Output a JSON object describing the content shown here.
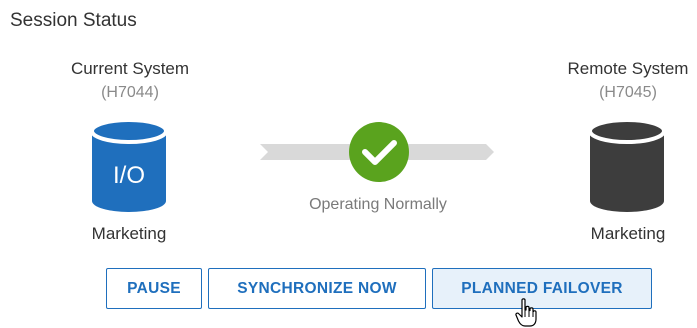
{
  "section": {
    "title": "Session Status"
  },
  "current_system": {
    "name": "Current System",
    "id": "(H7044)",
    "disk_label": "I/O",
    "site": "Marketing"
  },
  "remote_system": {
    "name": "Remote System",
    "id": "(H7045)",
    "site": "Marketing"
  },
  "link": {
    "status": "Operating Normally",
    "status_color": "#5aa31e",
    "status_icon": "checkmark-icon"
  },
  "buttons": {
    "pause": "PAUSE",
    "sync": "SYNCHRONIZE NOW",
    "failover": "PLANNED FAILOVER"
  },
  "colors": {
    "accent": "#1f6fbd",
    "disk_active": "#1f6fbd",
    "disk_remote": "#3d3d3d",
    "link_bar": "#d9d9d9"
  }
}
